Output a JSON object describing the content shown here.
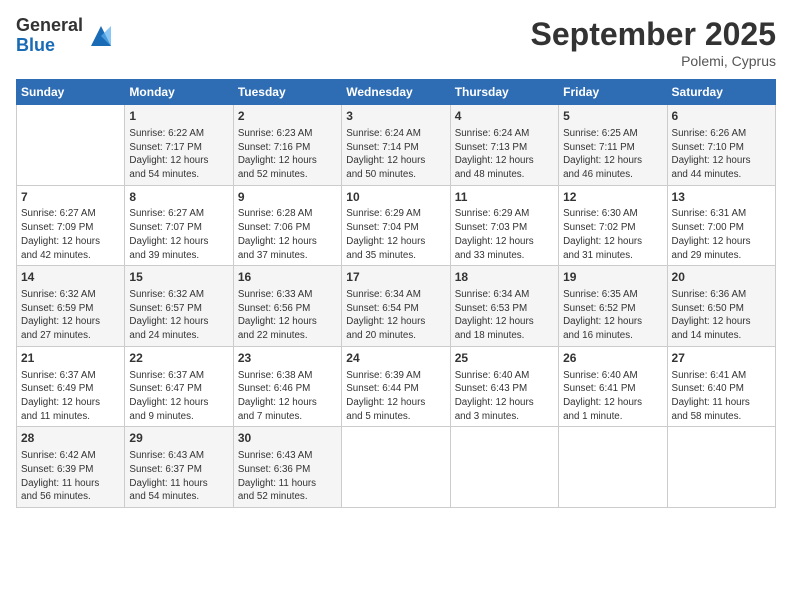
{
  "header": {
    "logo_general": "General",
    "logo_blue": "Blue",
    "month_title": "September 2025",
    "subtitle": "Polemi, Cyprus"
  },
  "columns": [
    "Sunday",
    "Monday",
    "Tuesday",
    "Wednesday",
    "Thursday",
    "Friday",
    "Saturday"
  ],
  "weeks": [
    [
      {
        "day": "",
        "info": ""
      },
      {
        "day": "1",
        "info": "Sunrise: 6:22 AM\nSunset: 7:17 PM\nDaylight: 12 hours\nand 54 minutes."
      },
      {
        "day": "2",
        "info": "Sunrise: 6:23 AM\nSunset: 7:16 PM\nDaylight: 12 hours\nand 52 minutes."
      },
      {
        "day": "3",
        "info": "Sunrise: 6:24 AM\nSunset: 7:14 PM\nDaylight: 12 hours\nand 50 minutes."
      },
      {
        "day": "4",
        "info": "Sunrise: 6:24 AM\nSunset: 7:13 PM\nDaylight: 12 hours\nand 48 minutes."
      },
      {
        "day": "5",
        "info": "Sunrise: 6:25 AM\nSunset: 7:11 PM\nDaylight: 12 hours\nand 46 minutes."
      },
      {
        "day": "6",
        "info": "Sunrise: 6:26 AM\nSunset: 7:10 PM\nDaylight: 12 hours\nand 44 minutes."
      }
    ],
    [
      {
        "day": "7",
        "info": "Sunrise: 6:27 AM\nSunset: 7:09 PM\nDaylight: 12 hours\nand 42 minutes."
      },
      {
        "day": "8",
        "info": "Sunrise: 6:27 AM\nSunset: 7:07 PM\nDaylight: 12 hours\nand 39 minutes."
      },
      {
        "day": "9",
        "info": "Sunrise: 6:28 AM\nSunset: 7:06 PM\nDaylight: 12 hours\nand 37 minutes."
      },
      {
        "day": "10",
        "info": "Sunrise: 6:29 AM\nSunset: 7:04 PM\nDaylight: 12 hours\nand 35 minutes."
      },
      {
        "day": "11",
        "info": "Sunrise: 6:29 AM\nSunset: 7:03 PM\nDaylight: 12 hours\nand 33 minutes."
      },
      {
        "day": "12",
        "info": "Sunrise: 6:30 AM\nSunset: 7:02 PM\nDaylight: 12 hours\nand 31 minutes."
      },
      {
        "day": "13",
        "info": "Sunrise: 6:31 AM\nSunset: 7:00 PM\nDaylight: 12 hours\nand 29 minutes."
      }
    ],
    [
      {
        "day": "14",
        "info": "Sunrise: 6:32 AM\nSunset: 6:59 PM\nDaylight: 12 hours\nand 27 minutes."
      },
      {
        "day": "15",
        "info": "Sunrise: 6:32 AM\nSunset: 6:57 PM\nDaylight: 12 hours\nand 24 minutes."
      },
      {
        "day": "16",
        "info": "Sunrise: 6:33 AM\nSunset: 6:56 PM\nDaylight: 12 hours\nand 22 minutes."
      },
      {
        "day": "17",
        "info": "Sunrise: 6:34 AM\nSunset: 6:54 PM\nDaylight: 12 hours\nand 20 minutes."
      },
      {
        "day": "18",
        "info": "Sunrise: 6:34 AM\nSunset: 6:53 PM\nDaylight: 12 hours\nand 18 minutes."
      },
      {
        "day": "19",
        "info": "Sunrise: 6:35 AM\nSunset: 6:52 PM\nDaylight: 12 hours\nand 16 minutes."
      },
      {
        "day": "20",
        "info": "Sunrise: 6:36 AM\nSunset: 6:50 PM\nDaylight: 12 hours\nand 14 minutes."
      }
    ],
    [
      {
        "day": "21",
        "info": "Sunrise: 6:37 AM\nSunset: 6:49 PM\nDaylight: 12 hours\nand 11 minutes."
      },
      {
        "day": "22",
        "info": "Sunrise: 6:37 AM\nSunset: 6:47 PM\nDaylight: 12 hours\nand 9 minutes."
      },
      {
        "day": "23",
        "info": "Sunrise: 6:38 AM\nSunset: 6:46 PM\nDaylight: 12 hours\nand 7 minutes."
      },
      {
        "day": "24",
        "info": "Sunrise: 6:39 AM\nSunset: 6:44 PM\nDaylight: 12 hours\nand 5 minutes."
      },
      {
        "day": "25",
        "info": "Sunrise: 6:40 AM\nSunset: 6:43 PM\nDaylight: 12 hours\nand 3 minutes."
      },
      {
        "day": "26",
        "info": "Sunrise: 6:40 AM\nSunset: 6:41 PM\nDaylight: 12 hours\nand 1 minute."
      },
      {
        "day": "27",
        "info": "Sunrise: 6:41 AM\nSunset: 6:40 PM\nDaylight: 11 hours\nand 58 minutes."
      }
    ],
    [
      {
        "day": "28",
        "info": "Sunrise: 6:42 AM\nSunset: 6:39 PM\nDaylight: 11 hours\nand 56 minutes."
      },
      {
        "day": "29",
        "info": "Sunrise: 6:43 AM\nSunset: 6:37 PM\nDaylight: 11 hours\nand 54 minutes."
      },
      {
        "day": "30",
        "info": "Sunrise: 6:43 AM\nSunset: 6:36 PM\nDaylight: 11 hours\nand 52 minutes."
      },
      {
        "day": "",
        "info": ""
      },
      {
        "day": "",
        "info": ""
      },
      {
        "day": "",
        "info": ""
      },
      {
        "day": "",
        "info": ""
      }
    ]
  ]
}
